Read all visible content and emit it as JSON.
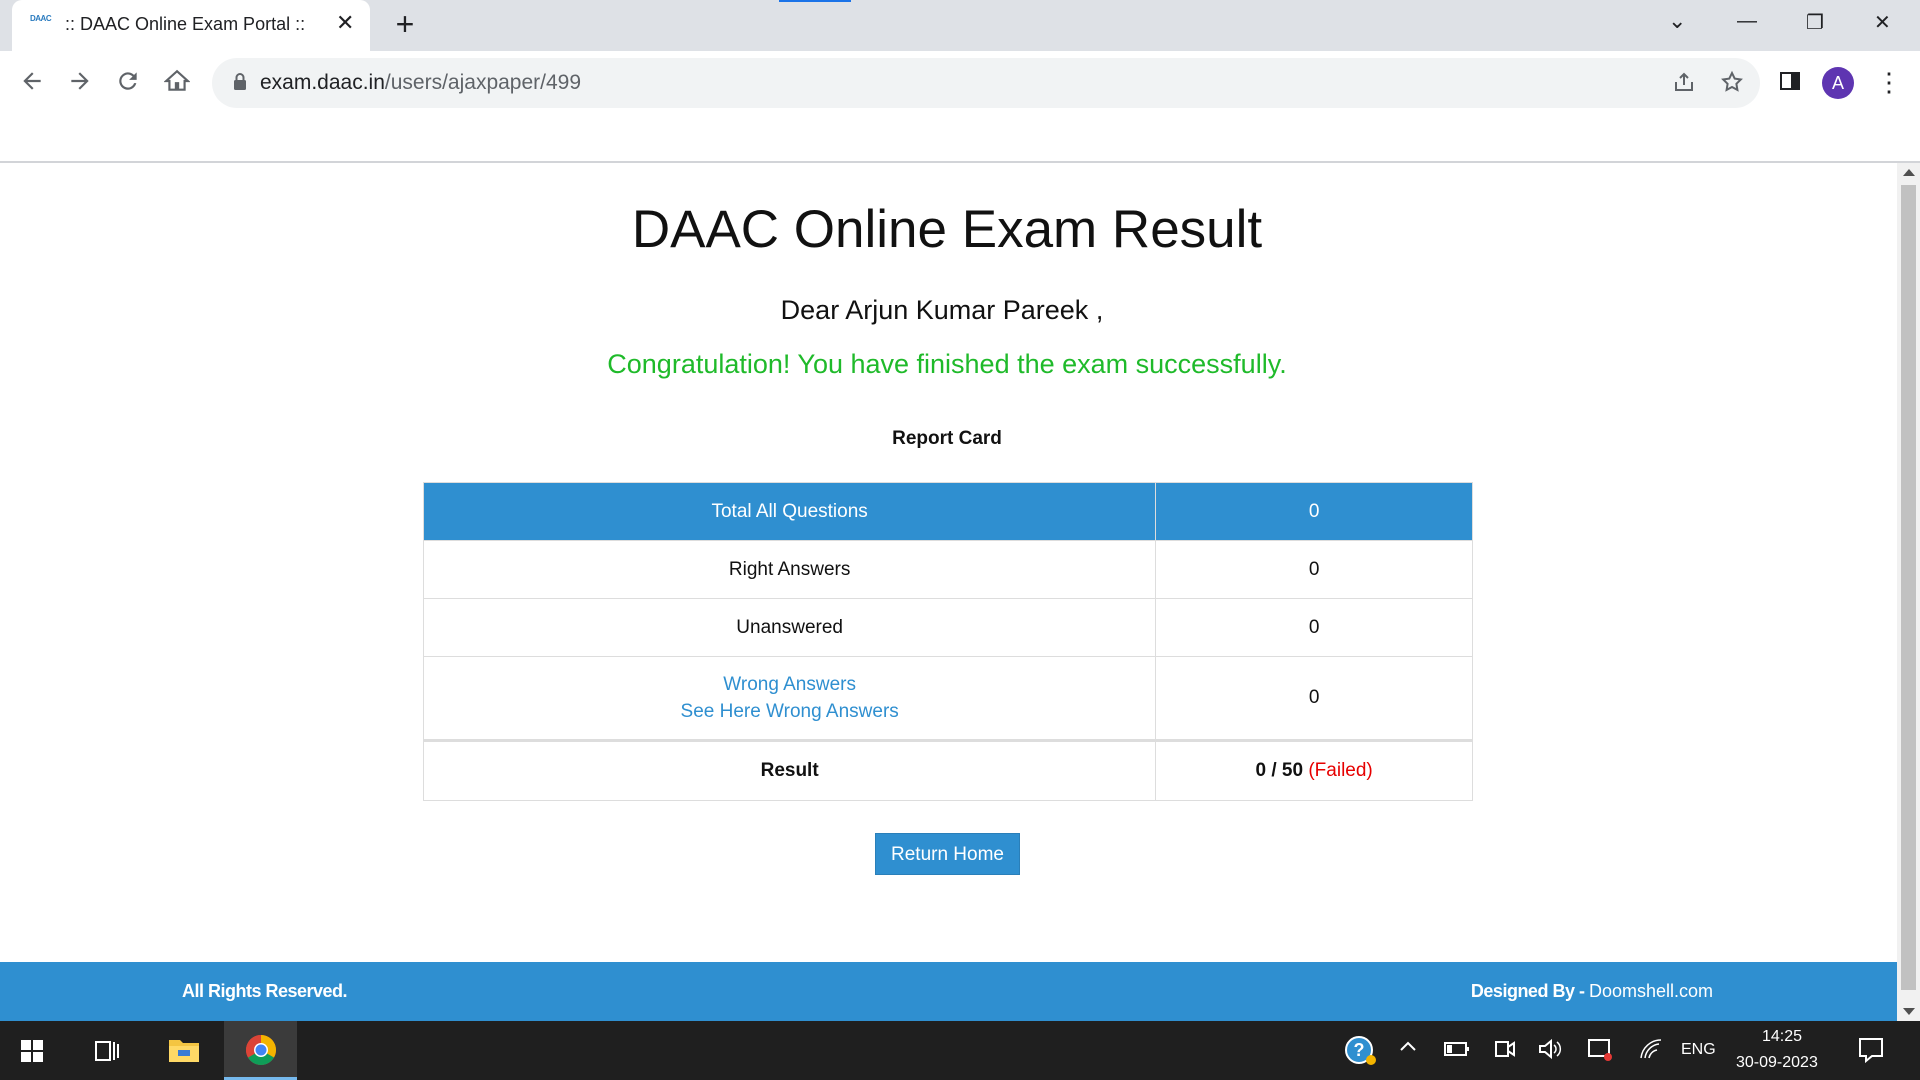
{
  "browser": {
    "tab_title": ":: DAAC Online Exam Portal ::",
    "tab_close": "✕",
    "new_tab": "+",
    "favicon_text": "DAAC",
    "url_domain": "exam.daac.in",
    "url_path": "/users/ajaxpaper/499",
    "avatar_letter": "A",
    "win_min": "—",
    "win_restore": "❐",
    "win_close": "✕",
    "tab_search": "⌄",
    "menu": "⋮"
  },
  "page": {
    "title": "DAAC Online Exam Result",
    "greeting": "Dear Arjun Kumar Pareek ,",
    "congrats": "Congratulation! You have finished the exam successfully.",
    "report_title": "Report Card",
    "table": {
      "header": {
        "label": "Total All Questions",
        "value": "0"
      },
      "right": {
        "label": "Right Answers",
        "value": "0"
      },
      "unanswered": {
        "label": "Unanswered",
        "value": "0"
      },
      "wrong": {
        "label": "Wrong Answers",
        "link": "See Here Wrong Answers",
        "value": "0"
      },
      "result": {
        "label": "Result",
        "score": "0 / 50",
        "status": "(Failed)"
      }
    },
    "return_button": "Return Home",
    "footer": {
      "left": "All Rights Reserved.",
      "right_label": "Designed By - ",
      "right_link": "Doomshell.com"
    }
  },
  "taskbar": {
    "language": "ENG",
    "time": "14:25",
    "date": "30-09-2023"
  },
  "colors": {
    "accent": "#2f8fd0",
    "success": "#1fba2a",
    "failed": "#e60000",
    "avatar": "#5e35b1"
  },
  "icons": [
    "back-arrow-icon",
    "forward-arrow-icon",
    "reload-icon",
    "home-icon",
    "lock-icon",
    "share-icon",
    "star-icon",
    "side-panel-icon",
    "windows-start-icon",
    "task-view-icon",
    "file-explorer-icon",
    "chrome-icon",
    "help-icon",
    "chevron-up-icon",
    "battery-icon",
    "meet-icon",
    "volume-icon",
    "display-icon",
    "wifi-icon",
    "notification-icon"
  ]
}
